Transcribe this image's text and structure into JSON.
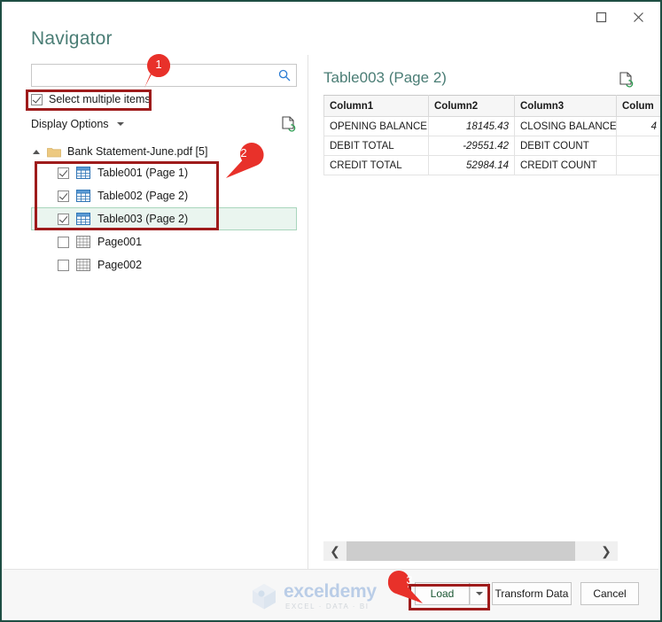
{
  "window": {
    "maximize_label": "Maximize",
    "close_label": "Close",
    "title": "Navigator"
  },
  "search": {
    "value": "",
    "placeholder": "",
    "icon": "search-icon"
  },
  "options": {
    "select_multiple_label": "Select multiple items",
    "select_multiple_checked": true,
    "display_options_label": "Display Options",
    "refresh_icon": "refresh-document-icon"
  },
  "tree": {
    "root": {
      "label": "Bank Statement-June.pdf [5]",
      "icon": "folder-icon",
      "expanded": true
    },
    "items": [
      {
        "label": "Table001 (Page 1)",
        "checked": true,
        "icon": "table-grid-icon",
        "selected": false
      },
      {
        "label": "Table002 (Page 2)",
        "checked": true,
        "icon": "table-grid-icon",
        "selected": false
      },
      {
        "label": "Table003 (Page 2)",
        "checked": true,
        "icon": "table-grid-icon",
        "selected": true
      },
      {
        "label": "Page001",
        "checked": false,
        "icon": "page-grid-icon",
        "selected": false
      },
      {
        "label": "Page002",
        "checked": false,
        "icon": "page-grid-icon",
        "selected": false
      }
    ]
  },
  "preview": {
    "title": "Table003 (Page 2)",
    "doc_icon": "refresh-document-icon",
    "columns": [
      "Column1",
      "Column2",
      "Column3",
      "Colum"
    ],
    "rows": [
      [
        "OPENING BALANCE",
        "18145.43",
        "CLOSING BALANCE",
        "4"
      ],
      [
        "DEBIT TOTAL",
        "-29551.42",
        "DEBIT COUNT",
        ""
      ],
      [
        "CREDIT TOTAL",
        "52984.14",
        "CREDIT COUNT",
        ""
      ]
    ],
    "scroll": {
      "left_arrow": "❮",
      "right_arrow": "❯"
    }
  },
  "footer": {
    "load_label": "Load",
    "load_dropdown_icon": "caret-down-icon",
    "transform_label": "Transform Data",
    "cancel_label": "Cancel",
    "watermark_main": "exceldemy",
    "watermark_sub": "EXCEL · DATA · BI"
  },
  "annotations": {
    "callouts": [
      {
        "number": "1"
      },
      {
        "number": "2"
      },
      {
        "number": "3"
      }
    ],
    "box_color": "#9e1b1b",
    "pin_color": "#e8312a"
  }
}
